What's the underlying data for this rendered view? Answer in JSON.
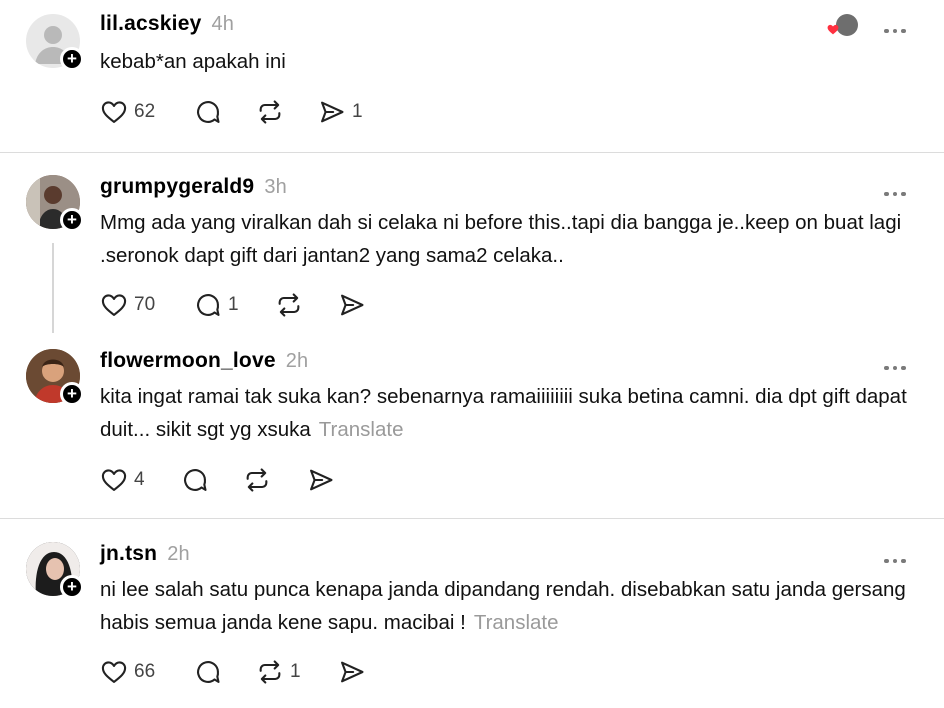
{
  "posts": [
    {
      "username": "lil.acskiey",
      "time": "4h",
      "text": "kebab*an apakah ini",
      "translate": "",
      "likes": "62",
      "replies": "",
      "reposts": "",
      "shares": "1"
    },
    {
      "username": "grumpygerald9",
      "time": "3h",
      "text": "Mmg ada yang viralkan dah si celaka ni before this..tapi dia bangga je..keep on buat lagi .seronok dapt gift dari jantan2 yang sama2 celaka..",
      "translate": "",
      "likes": "70",
      "replies": "1",
      "reposts": "",
      "shares": ""
    },
    {
      "username": "flowermoon_love",
      "time": "2h",
      "text": "kita ingat ramai tak suka kan? sebenarnya ramaiiiiiiii suka betina camni. dia dpt gift dapat duit... sikit sgt yg xsuka",
      "translate": "Translate",
      "likes": "4",
      "replies": "",
      "reposts": "",
      "shares": ""
    },
    {
      "username": "jn.tsn",
      "time": "2h",
      "text": "ni lee salah satu punca kenapa janda dipandang rendah. disebabkan satu janda gersang habis semua janda kene sapu. macibai !",
      "translate": "Translate",
      "likes": "66",
      "replies": "",
      "reposts": "1",
      "shares": ""
    }
  ],
  "icons": {
    "like": "heart-icon",
    "reply": "comment-icon",
    "repost": "repost-icon",
    "share": "send-icon",
    "more": "more-icon",
    "follow": "plus-icon"
  },
  "colors": {
    "muted": "#a0a0a0",
    "divider": "#dcdcdc",
    "heart": "#ff3040"
  }
}
